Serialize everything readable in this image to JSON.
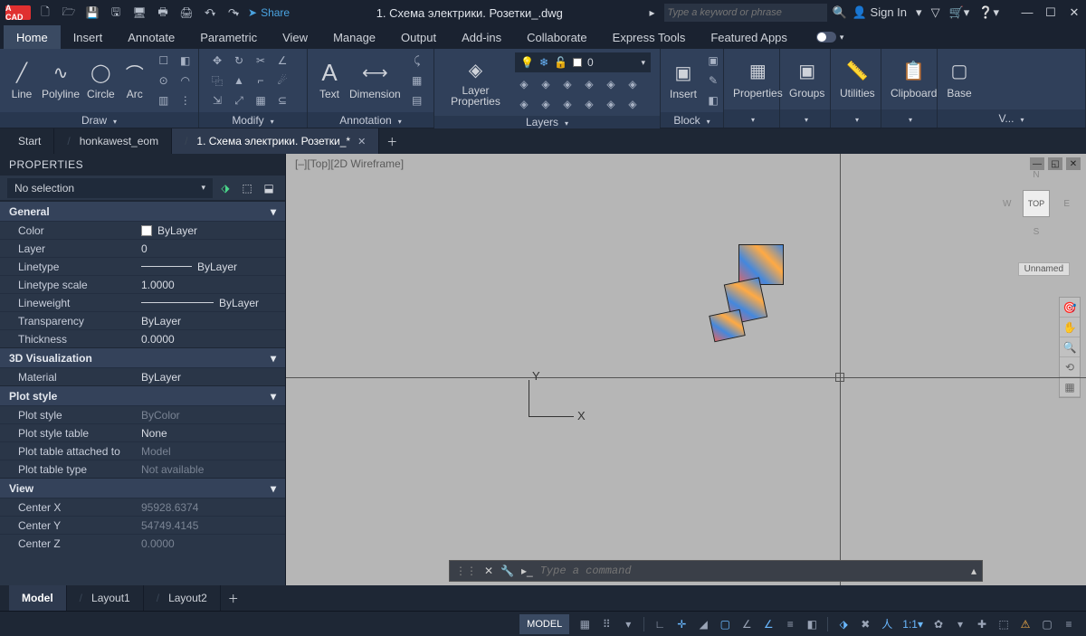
{
  "app": {
    "logo": "A CAD",
    "title": "1. Схема электрики. Розетки_.dwg"
  },
  "qat": {
    "share": "Share"
  },
  "search": {
    "placeholder": "Type a keyword or phrase"
  },
  "signin": "Sign In",
  "ribbon_tabs": [
    "Home",
    "Insert",
    "Annotate",
    "Parametric",
    "View",
    "Manage",
    "Output",
    "Add-ins",
    "Collaborate",
    "Express Tools",
    "Featured Apps"
  ],
  "ribbon": {
    "draw": {
      "label": "Draw",
      "tools": [
        "Line",
        "Polyline",
        "Circle",
        "Arc"
      ]
    },
    "modify": {
      "label": "Modify"
    },
    "annotation": {
      "label": "Annotation",
      "text": "Text",
      "dimension": "Dimension"
    },
    "layerprops": {
      "label": "Layer\nProperties",
      "panel_label": "Layers",
      "current": "0"
    },
    "block": {
      "label": "Block",
      "insert": "Insert"
    },
    "properties": "Properties",
    "groups": "Groups",
    "utilities": "Utilities",
    "clipboard": "Clipboard",
    "view": {
      "label": "V...",
      "base": "Base"
    }
  },
  "filetabs": [
    {
      "label": "Start",
      "active": false
    },
    {
      "label": "honkawest_eom",
      "active": false
    },
    {
      "label": "1. Схема электрики. Розетки_*",
      "active": true
    }
  ],
  "properties": {
    "title": "PROPERTIES",
    "selection": "No selection",
    "sections": {
      "general": {
        "title": "General",
        "color": {
          "label": "Color",
          "value": "ByLayer"
        },
        "layer": {
          "label": "Layer",
          "value": "0"
        },
        "linetype": {
          "label": "Linetype",
          "value": "ByLayer"
        },
        "ltscale": {
          "label": "Linetype scale",
          "value": "1.0000"
        },
        "lineweight": {
          "label": "Lineweight",
          "value": "ByLayer"
        },
        "transp": {
          "label": "Transparency",
          "value": "ByLayer"
        },
        "thick": {
          "label": "Thickness",
          "value": "0.0000"
        }
      },
      "viz3d": {
        "title": "3D Visualization",
        "material": {
          "label": "Material",
          "value": "ByLayer"
        }
      },
      "plot": {
        "title": "Plot style",
        "pstyle": {
          "label": "Plot style",
          "value": "ByColor"
        },
        "ptable": {
          "label": "Plot style table",
          "value": "None"
        },
        "pattached": {
          "label": "Plot table attached to",
          "value": "Model"
        },
        "ptype": {
          "label": "Plot table type",
          "value": "Not available"
        }
      },
      "view": {
        "title": "View",
        "cx": {
          "label": "Center X",
          "value": "95928.6374"
        },
        "cy": {
          "label": "Center Y",
          "value": "54749.4145"
        },
        "cz": {
          "label": "Center Z",
          "value": "0.0000"
        }
      }
    }
  },
  "viewport": {
    "label": "[‒][Top][2D Wireframe]",
    "cube_face": "TOP",
    "cube_dirs": {
      "n": "N",
      "s": "S",
      "e": "E",
      "w": "W"
    },
    "unnamed": "Unnamed",
    "ucs": {
      "x": "X",
      "y": "Y"
    }
  },
  "cmdline": {
    "placeholder": "Type a command",
    "prompt": "▸_"
  },
  "layout_tabs": [
    "Model",
    "Layout1",
    "Layout2"
  ],
  "statusbar": {
    "model": "MODEL",
    "scale": "1:1"
  }
}
